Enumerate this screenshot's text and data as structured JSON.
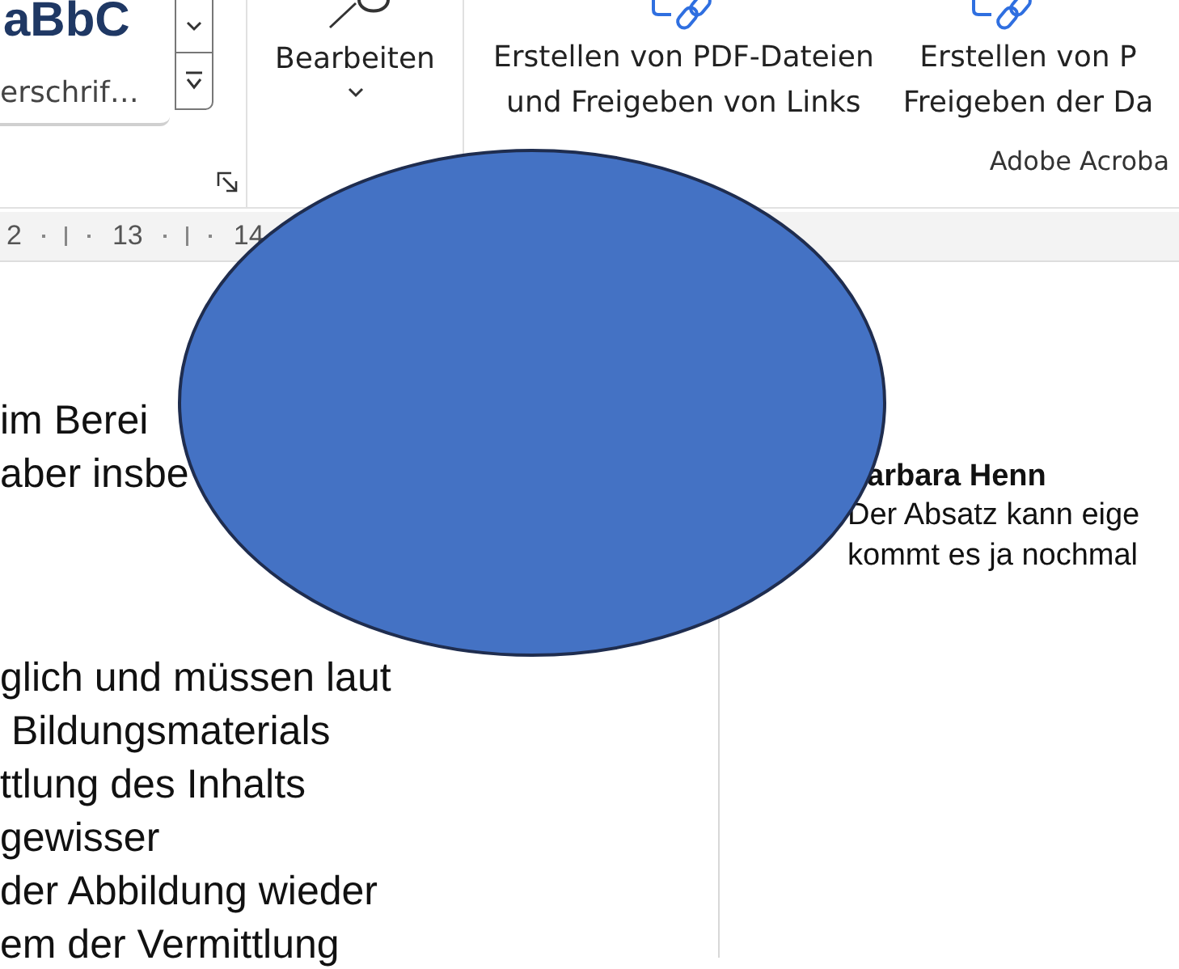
{
  "ribbon": {
    "styles": {
      "preview": "aBbC",
      "name": "erschrif…"
    },
    "edit_group": {
      "label": "Bearbeiten"
    },
    "acrobat_buttons": [
      {
        "line1": "Erstellen von PDF-Dateien",
        "line2": "und Freigeben von Links"
      },
      {
        "line1": "Erstellen von P",
        "line2": "Freigeben der Da"
      }
    ],
    "acrobat_group_label": "Adobe Acroba"
  },
  "ruler": {
    "labels": [
      "2",
      "13",
      "14"
    ]
  },
  "document": {
    "lines_top": [
      "im Berei",
      "aber insbe"
    ],
    "lines_bottom": [
      "glich und müssen laut",
      " Bildungsmaterials",
      "ttlung des Inhalts",
      "gewisser",
      "der Abbildung wieder",
      "em der Vermittlung"
    ]
  },
  "comment": {
    "author": "arbara Henn",
    "lines": [
      "Der Absatz kann eige",
      "kommt es ja nochmal"
    ]
  },
  "overlay": {
    "kind": "ellipse",
    "color": "#4472c4"
  }
}
